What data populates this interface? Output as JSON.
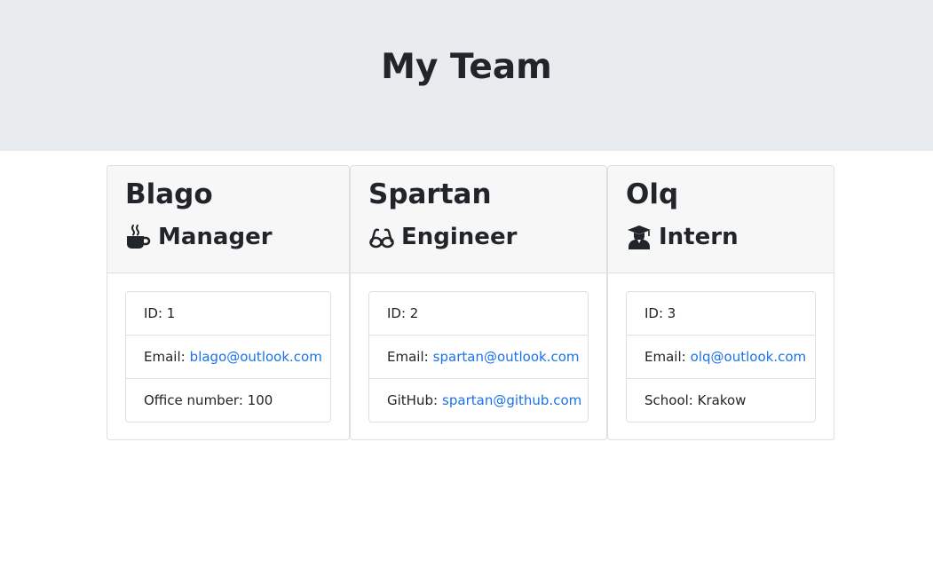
{
  "header": {
    "title": "My Team"
  },
  "colors": {
    "link": "#1a73e8",
    "header_bg": "#e9ecef",
    "card_header_bg": "#f7f7f7",
    "text": "#212529"
  },
  "cards": [
    {
      "name": "Blago",
      "role": "Manager",
      "icon": "coffee-icon",
      "id_label": "ID: 1",
      "email_label": "Email:",
      "email": "blago@outlook.com",
      "extra_label": "Office number: 100",
      "extra_link": ""
    },
    {
      "name": "Spartan",
      "role": "Engineer",
      "icon": "glasses-icon",
      "id_label": "ID: 2",
      "email_label": "Email:",
      "email": "spartan@outlook.com",
      "extra_label": "GitHub:",
      "extra_link": "spartan@github.com"
    },
    {
      "name": "Olq",
      "role": "Intern",
      "icon": "graduate-icon",
      "id_label": "ID: 3",
      "email_label": "Email:",
      "email": "olq@outlook.com",
      "extra_label": "School: Krakow",
      "extra_link": ""
    }
  ]
}
